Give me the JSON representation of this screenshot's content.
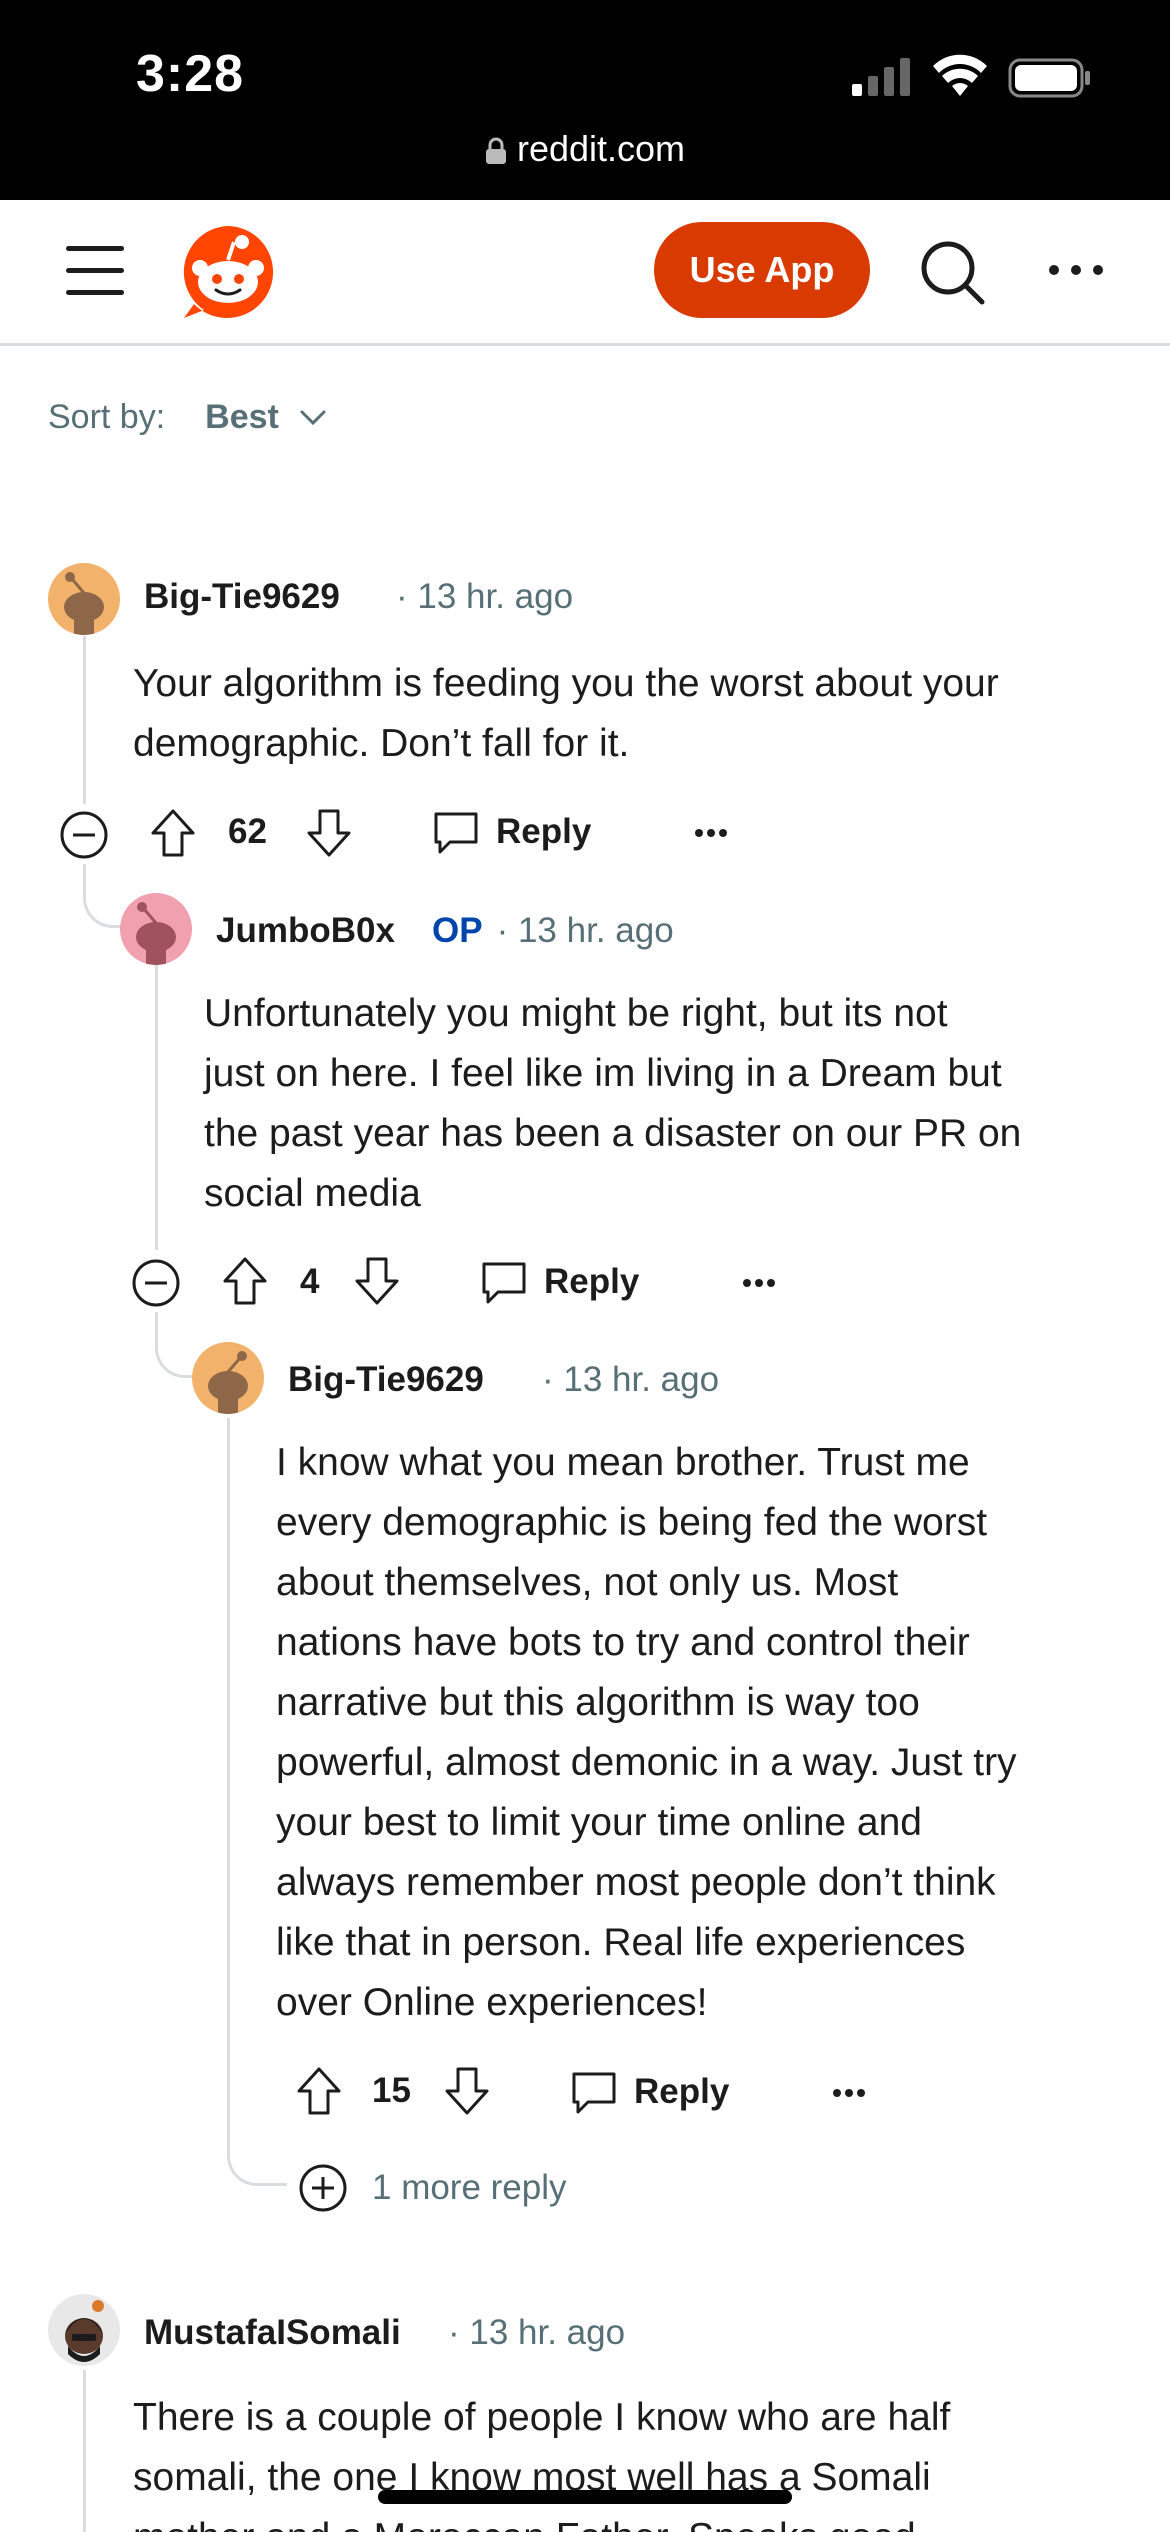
{
  "status_bar": {
    "time": "3:28",
    "url": "reddit.com"
  },
  "nav": {
    "use_app_label": "Use App"
  },
  "sort": {
    "label": "Sort by:",
    "value": "Best"
  },
  "comments": [
    {
      "author": "Big-Tie9629",
      "time": "13 hr. ago",
      "body_lines": [
        "Your algorithm is feeding you the worst about your",
        "demographic. Don’t fall for it."
      ],
      "score": "62",
      "reply_label": "Reply"
    },
    {
      "author": "JumboB0x",
      "op_badge": "OP",
      "time": "13 hr. ago",
      "body_lines": [
        "Unfortunately you might be right, but its not",
        "just on here. I feel like im living in a Dream but",
        "the past year has been a disaster on our PR on",
        "social media"
      ],
      "score": "4",
      "reply_label": "Reply"
    },
    {
      "author": "Big-Tie9629",
      "time": "13 hr. ago",
      "body_lines": [
        "I know what you mean brother. Trust me",
        "every demographic is being fed the worst",
        "about themselves, not only us. Most",
        "nations have bots to try and control their",
        "narrative but this algorithm is way too",
        "powerful, almost demonic in a way. Just try",
        "your best to limit your time online and",
        "always remember most people don’t think",
        "like that in person. Real life experiences",
        "over Online experiences!"
      ],
      "score": "15",
      "reply_label": "Reply",
      "more_replies": "1 more reply"
    },
    {
      "author": "MustafaISomali",
      "time": "13 hr. ago",
      "body_lines": [
        "There is a couple of people I know who are half",
        "somali, the one I know most well has a Somali",
        "mother and a Moroccan Father. Speaks good"
      ]
    }
  ],
  "icons": [
    "menu-icon",
    "reddit-logo-icon",
    "search-icon",
    "more-icon",
    "chevron-down-icon",
    "collapse-icon",
    "upvote-icon",
    "downvote-icon",
    "reply-icon",
    "expand-icon",
    "lock-icon"
  ],
  "colors": {
    "brand": "#d93a00",
    "op": "#0045ac",
    "meta": "#576f76"
  }
}
